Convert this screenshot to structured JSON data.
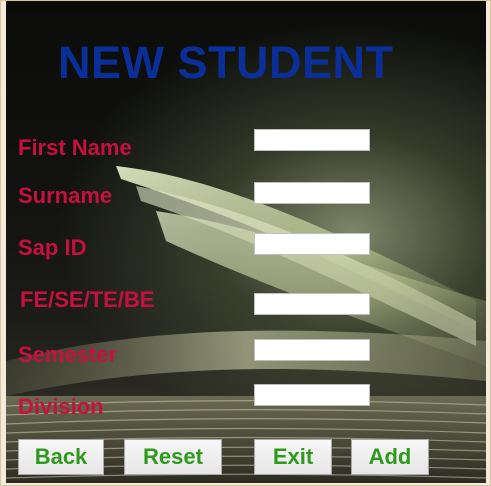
{
  "form": {
    "title": "NEW STUDENT",
    "fields": [
      {
        "label": "First Name",
        "value": ""
      },
      {
        "label": "Surname",
        "value": ""
      },
      {
        "label": "Sap ID",
        "value": ""
      },
      {
        "label": "FE/SE/TE/BE",
        "value": ""
      },
      {
        "label": "Semester",
        "value": ""
      },
      {
        "label": "Division",
        "value": ""
      }
    ],
    "buttons": {
      "back": "Back",
      "reset": "Reset",
      "exit": "Exit",
      "add": "Add"
    }
  },
  "colors": {
    "title": "#0b2f99",
    "label": "#c8103e",
    "button_text": "#2e9a1c"
  }
}
